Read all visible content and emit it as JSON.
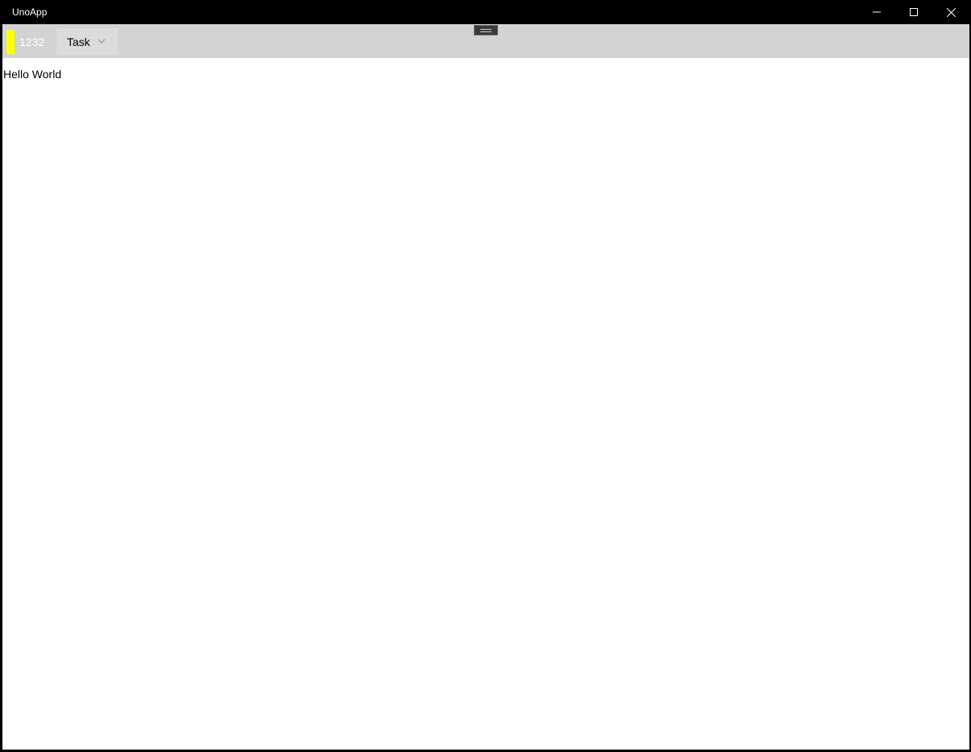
{
  "window": {
    "title": "UnoApp",
    "controls": {
      "minimize_icon": "minimize-icon",
      "maximize_icon": "maximize-icon",
      "close_icon": "close-icon"
    }
  },
  "toolbar": {
    "marker_color": "#ffff00",
    "count": "1232",
    "dropdown": {
      "selected": "Task",
      "icon": "chevron-down-icon"
    },
    "drag_handle_icon": "drag-handle-icon"
  },
  "main": {
    "text": "Hello World"
  }
}
